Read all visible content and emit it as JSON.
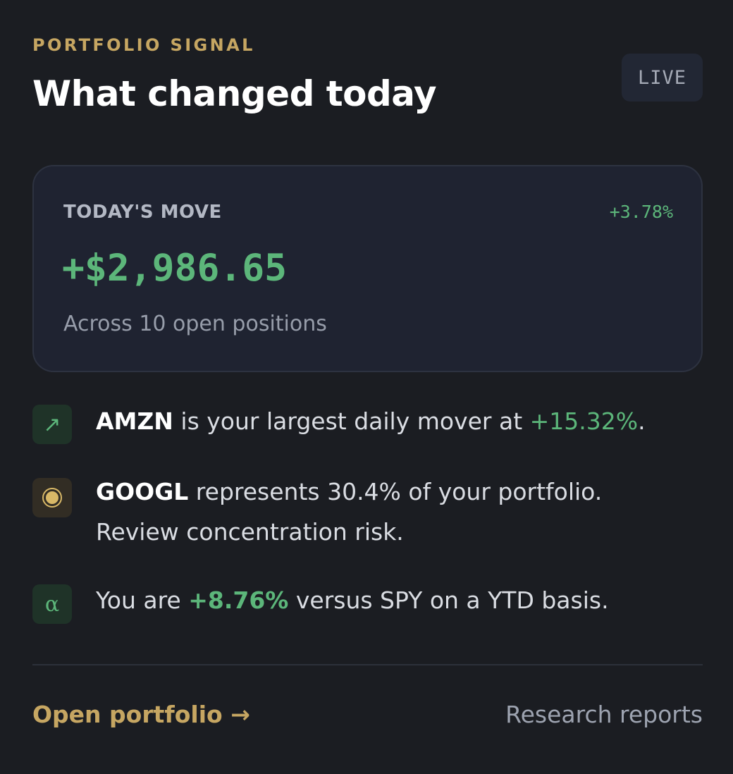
{
  "header": {
    "eyebrow": "PORTFOLIO SIGNAL",
    "title": "What changed today",
    "live_badge": "LIVE"
  },
  "today_move": {
    "label": "TODAY'S MOVE",
    "percent": "+3.78%",
    "amount": "+$2,986.65",
    "subtext": "Across 10 open positions"
  },
  "insights": [
    {
      "icon": "arrow-up-right-icon",
      "icon_glyph": "↗",
      "ticker": "AMZN",
      "text_before": " is your largest daily mover at ",
      "highlight": "+15.32%",
      "text_after": "."
    },
    {
      "icon": "target-icon",
      "ticker": "GOOGL",
      "text_line1": " represents 30.4% of your portfolio.",
      "text_line2": "Review concentration risk."
    },
    {
      "icon": "alpha-icon",
      "icon_glyph": "α",
      "text_before": "You are ",
      "highlight": "+8.76%",
      "text_after": " versus SPY on a YTD basis."
    }
  ],
  "footer": {
    "primary_link": "Open portfolio →",
    "secondary_link": "Research reports"
  },
  "colors": {
    "background": "#1b1d22",
    "accent_gold": "#c6a662",
    "positive_green": "#5cb67a",
    "card_bg": "#1f2331"
  }
}
